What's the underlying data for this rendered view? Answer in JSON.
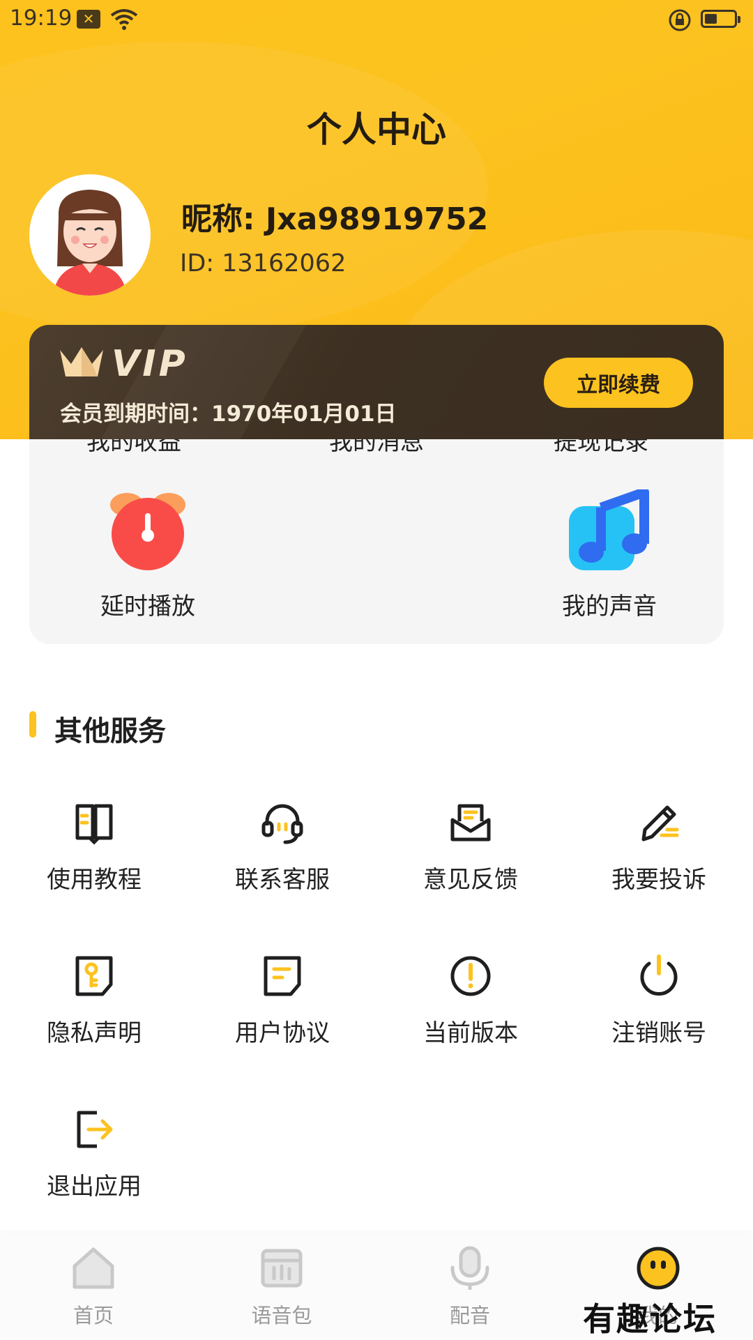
{
  "status_bar": {
    "time": "19:19"
  },
  "header": {
    "title": "个人中心",
    "nickname": "昵称: Jxa98919752",
    "user_id": "ID: 13162062"
  },
  "vip": {
    "badge": "VIP",
    "expiry": "会员到期时间：1970年01月01日",
    "renew_label": "立即续费"
  },
  "features": {
    "partial_row": [
      "我的收益",
      "我的消息",
      "提现记录"
    ],
    "items": [
      {
        "label": "延时播放",
        "icon": "alarm-clock-icon"
      },
      {
        "label": "我的声音",
        "icon": "music-note-icon"
      }
    ]
  },
  "other_services": {
    "title": "其他服务",
    "items": [
      {
        "label": "使用教程",
        "icon": "book-icon"
      },
      {
        "label": "联系客服",
        "icon": "headset-icon"
      },
      {
        "label": "意见反馈",
        "icon": "mail-icon"
      },
      {
        "label": "我要投诉",
        "icon": "pencil-icon"
      },
      {
        "label": "隐私声明",
        "icon": "key-icon"
      },
      {
        "label": "用户协议",
        "icon": "document-icon"
      },
      {
        "label": "当前版本",
        "icon": "info-icon"
      },
      {
        "label": "注销账号",
        "icon": "power-icon"
      },
      {
        "label": "退出应用",
        "icon": "exit-icon"
      }
    ]
  },
  "bottom_nav": [
    {
      "label": "首页",
      "icon": "home-icon"
    },
    {
      "label": "语音包",
      "icon": "voice-pack-icon"
    },
    {
      "label": "配音",
      "icon": "microphone-icon"
    },
    {
      "label": "我的",
      "icon": "profile-face-icon"
    }
  ],
  "watermark": "有趣论坛",
  "colors": {
    "accent": "#fcc21f",
    "vip_card": "#3d3022",
    "text": "#1f1f1f"
  }
}
